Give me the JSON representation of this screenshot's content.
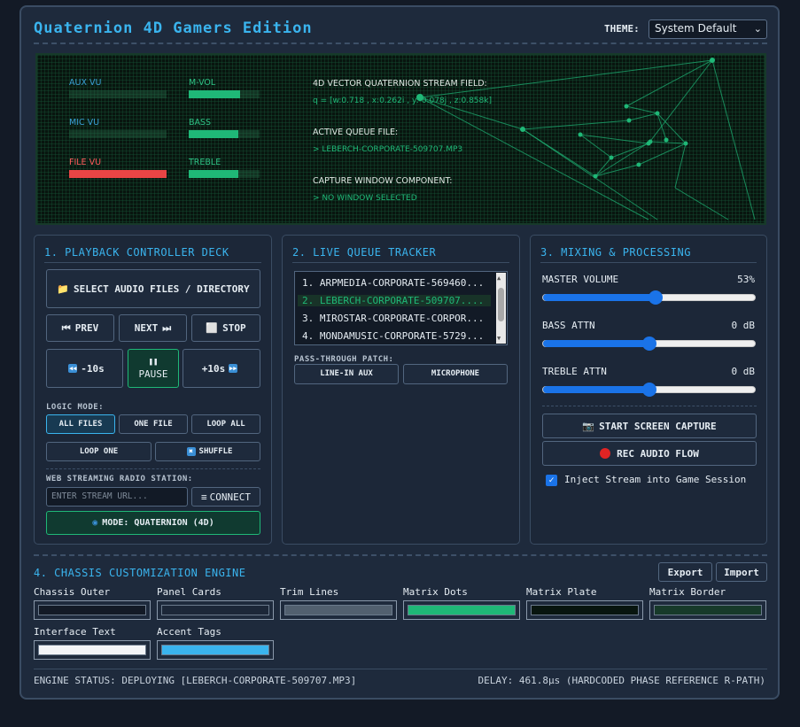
{
  "app": {
    "title": "Quaternion 4D Gamers Edition",
    "theme_label": "THEME:",
    "theme_value": "System Default"
  },
  "matrix": {
    "meters": [
      {
        "label": "AUX VU",
        "level": 0.0,
        "color": "#3a9fd6"
      },
      {
        "label": "MIC VU",
        "level": 0.0,
        "color": "#3a9fd6"
      },
      {
        "label": "FILE VU",
        "level": 1.0,
        "color": "#ff5c5c"
      },
      {
        "label": "M-VOL",
        "level": 0.72,
        "color": "#2ec184"
      },
      {
        "label": "BASS",
        "level": 0.7,
        "color": "#2ec184"
      },
      {
        "label": "TREBLE",
        "level": 0.7,
        "color": "#2ec184"
      }
    ],
    "stream_field_label": "4D VECTOR QUATERNION STREAM FIELD:",
    "stream_field_value": "q = [w:0.718 , x:0.262i , y:-0.078j , z:0.858k]",
    "queue_file_label": "ACTIVE QUEUE FILE:",
    "queue_file_value": "> LEBERCH-CORPORATE-509707.MP3",
    "capture_label": "CAPTURE WINDOW COMPONENT:",
    "capture_value": "> NO WINDOW SELECTED"
  },
  "playback": {
    "title": "1. PLAYBACK CONTROLLER DECK",
    "select_files": "SELECT AUDIO FILES / DIRECTORY",
    "prev": "PREV",
    "next": "NEXT",
    "stop": "STOP",
    "back10": "-10s",
    "pause": "PAUSE",
    "fwd10": "+10s",
    "logic_mode_label": "LOGIC MODE:",
    "modes": [
      "ALL FILES",
      "ONE FILE",
      "LOOP ALL",
      "LOOP ONE",
      "SHUFFLE"
    ],
    "radio_label": "WEB STREAMING RADIO STATION:",
    "radio_placeholder": "ENTER STREAM URL...",
    "connect": "CONNECT",
    "mode_button": "MODE: QUATERNION (4D)"
  },
  "queue": {
    "title": "2. LIVE QUEUE TRACKER",
    "items": [
      "1. ARPMEDIA-CORPORATE-569460...",
      "2. LEBERCH-CORPORATE-509707....",
      "3. MIROSTAR-CORPORATE-CORPOR...",
      "4. MONDAMUSIC-CORPORATE-5729..."
    ],
    "active_index": 1,
    "patch_label": "PASS-THROUGH PATCH:",
    "line_in": "LINE-IN AUX",
    "microphone": "MICROPHONE"
  },
  "mixing": {
    "title": "3. MIXING & PROCESSING",
    "master_label": "MASTER VOLUME",
    "master_value": "53%",
    "master_level": 0.53,
    "bass_label": "BASS ATTN",
    "bass_value": "0 dB",
    "bass_level": 0.5,
    "treble_label": "TREBLE ATTN",
    "treble_value": "0 dB",
    "treble_level": 0.5,
    "screen_capture": "START SCREEN CAPTURE",
    "rec_audio": "REC AUDIO FLOW",
    "inject_label": "Inject Stream into Game Session",
    "inject_checked": true
  },
  "chassis": {
    "title": "4. CHASSIS CUSTOMIZATION ENGINE",
    "export": "Export",
    "import": "Import",
    "swatches": [
      {
        "label": "Chassis Outer",
        "color": "#131a26"
      },
      {
        "label": "Panel Cards",
        "color": "#1c2738"
      },
      {
        "label": "Trim Lines",
        "color": "#52606f"
      },
      {
        "label": "Matrix Dots",
        "color": "#1fb877"
      },
      {
        "label": "Matrix Plate",
        "color": "#08150f"
      },
      {
        "label": "Matrix Border",
        "color": "#173a2a"
      },
      {
        "label": "Interface Text",
        "color": "#f2f4f7"
      },
      {
        "label": "Accent Tags",
        "color": "#3ab4ee"
      }
    ]
  },
  "footer": {
    "status": "ENGINE STATUS: DEPLOYING [LEBERCH-CORPORATE-509707.MP3]",
    "delay": "DELAY: 461.8µs (HARDCODED PHASE REFERENCE R-PATH)"
  }
}
